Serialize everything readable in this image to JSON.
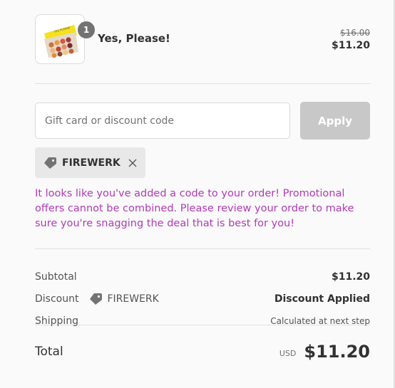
{
  "product": {
    "quantity": "1",
    "name": "Yes, Please!",
    "original_price": "$16.00",
    "sale_price": "$11.20",
    "image_icon": "eyeshadow-palette"
  },
  "discount": {
    "placeholder": "Gift card or discount code",
    "value": "",
    "apply_label": "Apply",
    "applied_code": "FIREWERK",
    "message": "It looks like you've added a code to your order! Promotional offers cannot be combined. Please review your order to make sure you're snagging the deal that is best for you!"
  },
  "summary": {
    "subtotal_label": "Subtotal",
    "subtotal_value": "$11.20",
    "discount_label": "Discount",
    "discount_code": "FIREWERK",
    "discount_value": "Discount Applied",
    "shipping_label": "Shipping",
    "shipping_value": "Calculated at next step",
    "total_label": "Total",
    "currency": "USD",
    "total_value": "$11.20"
  },
  "colors": {
    "promo_message": "#b13bb8",
    "apply_button_disabled": "#c8c8c8",
    "chip_background": "#e8e8e8",
    "badge": "#737373"
  }
}
